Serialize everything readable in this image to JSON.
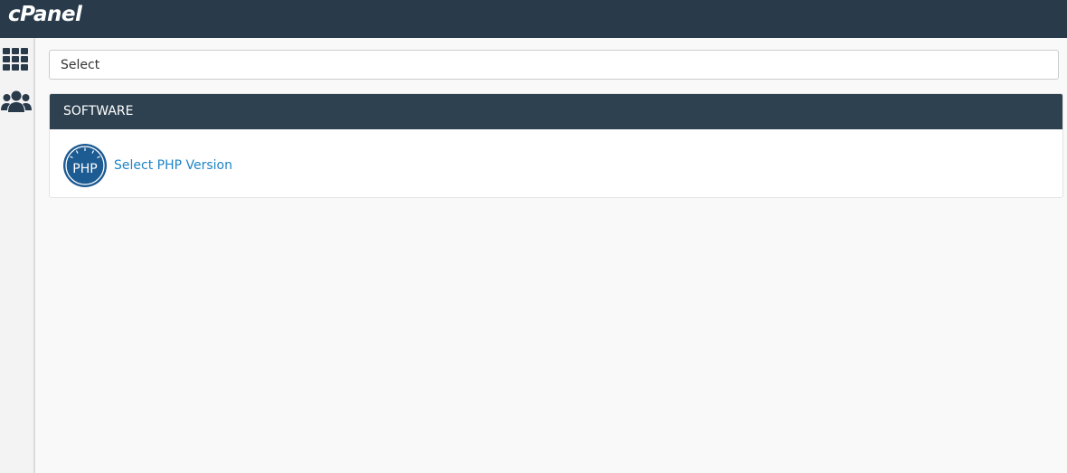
{
  "app": {
    "logo_text": "cPanel",
    "brand_color": "#293a4a",
    "link_color": "#1e84c7"
  },
  "sidebar": {
    "items": [
      {
        "icon": "grid-icon",
        "name": "tools"
      },
      {
        "icon": "users-icon",
        "name": "user-manager"
      }
    ]
  },
  "search": {
    "placeholder": "Select"
  },
  "sections": [
    {
      "title": "SOFTWARE",
      "items": [
        {
          "label": "Select PHP Version",
          "icon": "php-icon",
          "icon_text": "PHP"
        }
      ]
    }
  ]
}
